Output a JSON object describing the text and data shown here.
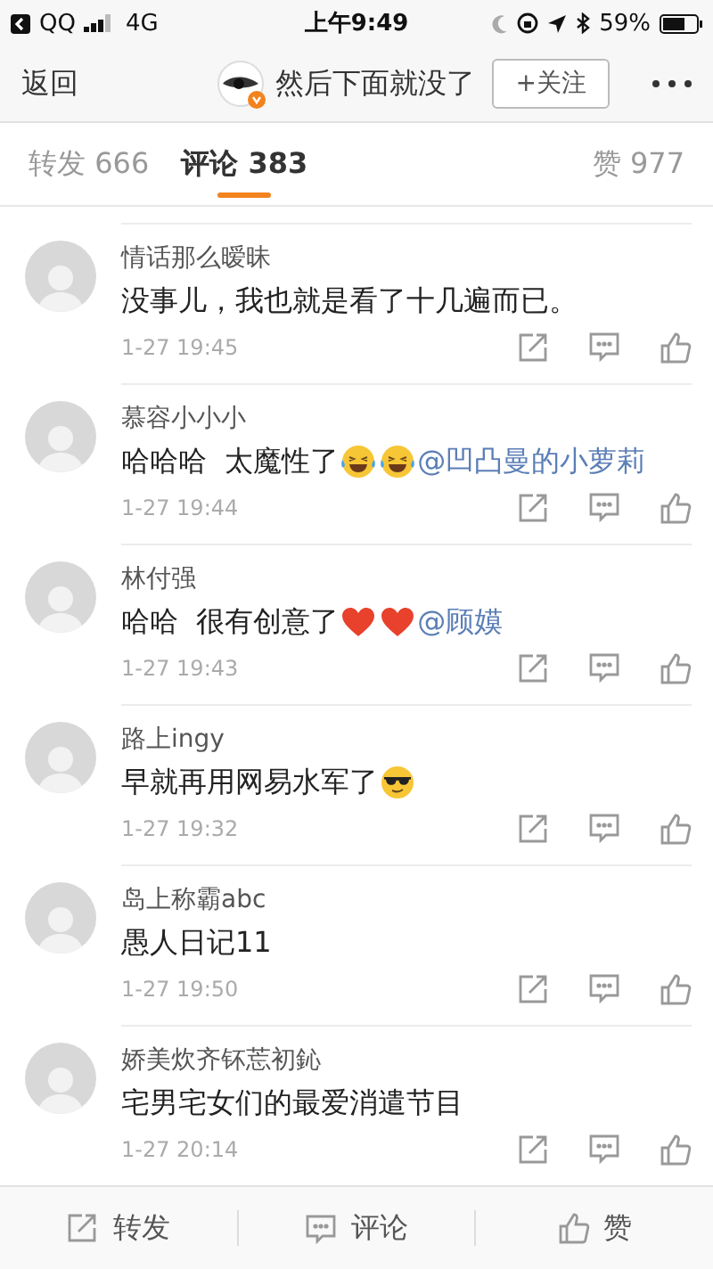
{
  "status_bar": {
    "back_app": "QQ",
    "network": "4G",
    "time": "上午9:49",
    "battery": "59%"
  },
  "nav": {
    "back": "返回",
    "title": "然后下面就没了",
    "follow": "+关注"
  },
  "tabs": [
    {
      "label": "转发 666",
      "selected": false
    },
    {
      "label": "评论 383",
      "selected": true
    },
    {
      "label": "赞 977",
      "selected": false
    }
  ],
  "comments": [
    {
      "user": "情话那么暧昧",
      "parts": [
        {
          "kind": "text",
          "text": "没事儿，我也就是看了十几遍而已。"
        }
      ],
      "time": "1-27 19:45"
    },
    {
      "user": "慕容小小小",
      "parts": [
        {
          "kind": "text",
          "text": "哈哈哈  太魔性了"
        },
        {
          "kind": "laugh-cry"
        },
        {
          "kind": "laugh-cry"
        },
        {
          "kind": "mention",
          "text": "@凹凸曼的小萝莉"
        }
      ],
      "time": "1-27 19:44"
    },
    {
      "user": "林付强",
      "parts": [
        {
          "kind": "text",
          "text": "哈哈  很有创意了"
        },
        {
          "kind": "heart"
        },
        {
          "kind": "heart"
        },
        {
          "kind": "mention",
          "text": "@顾嫫"
        }
      ],
      "time": "1-27 19:43"
    },
    {
      "user": "路上ingy",
      "parts": [
        {
          "kind": "text",
          "text": "早就再用网易水军了"
        },
        {
          "kind": "sunglasses"
        }
      ],
      "time": "1-27 19:32"
    },
    {
      "user": "岛上称霸abc",
      "parts": [
        {
          "kind": "text",
          "text": "愚人日记11"
        }
      ],
      "time": "1-27 19:50"
    },
    {
      "user": "娇美炊齐钚莣初鈊",
      "parts": [
        {
          "kind": "text",
          "text": "宅男宅女们的最爱消遣节目"
        }
      ],
      "time": "1-27 20:14"
    }
  ],
  "bottom_bar": [
    {
      "kind": "repost",
      "label": "转发"
    },
    {
      "kind": "comment",
      "label": "评论"
    },
    {
      "kind": "like",
      "label": "赞"
    }
  ]
}
